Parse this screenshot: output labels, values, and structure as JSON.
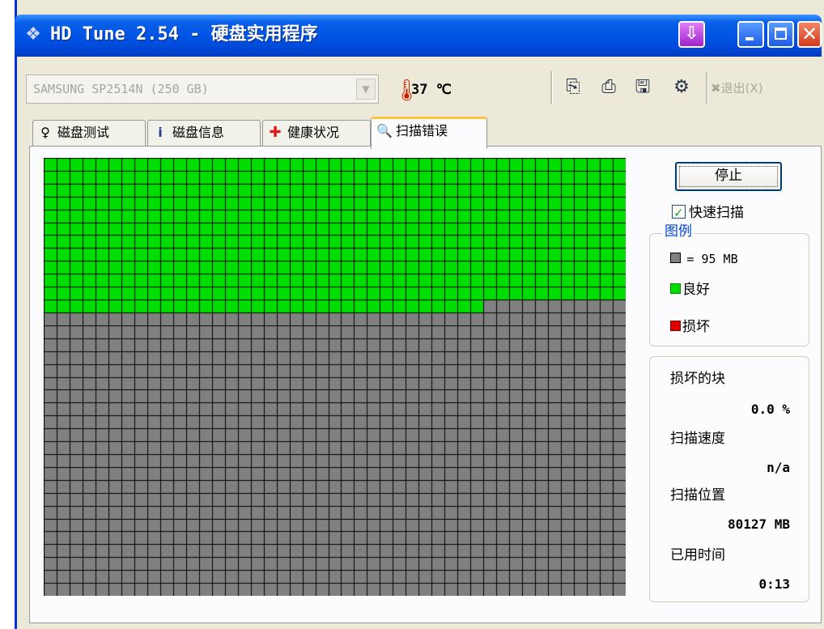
{
  "window": {
    "title": "HD Tune 2.54 - 硬盘实用程序"
  },
  "toolbar": {
    "drive": "SAMSUNG SP2514N (250 GB)",
    "temperature": "37 ℃",
    "exit_label": "退出(X)"
  },
  "tabs": [
    {
      "label": "磁盘测试",
      "icon": "benchmark-icon",
      "active": false
    },
    {
      "label": "磁盘信息",
      "icon": "info-icon",
      "active": false
    },
    {
      "label": "健康状况",
      "icon": "health-cross-icon",
      "active": false
    },
    {
      "label": "扫描错误",
      "icon": "magnifier-icon",
      "active": true
    }
  ],
  "scan": {
    "stop_label": "停止",
    "quick_scan_label": "快速扫描",
    "quick_scan_checked": true,
    "grid_columns": 45,
    "grid_rows": 34,
    "blocks_scanned": 529,
    "colors": {
      "good": "#00dd00",
      "bad": "#dd0000",
      "unscanned": "#808080"
    }
  },
  "legend": {
    "title": "图例",
    "block_size": "= 95 MB",
    "good_label": "良好",
    "damaged_label": "损坏"
  },
  "stats": {
    "damaged_blocks_label": "损坏的块",
    "damaged_blocks_value": "0.0 %",
    "scan_speed_label": "扫描速度",
    "scan_speed_value": "n/a",
    "scan_position_label": "扫描位置",
    "scan_position_value": "80127 MB",
    "elapsed_label": "已用时间",
    "elapsed_value": "0:13"
  }
}
